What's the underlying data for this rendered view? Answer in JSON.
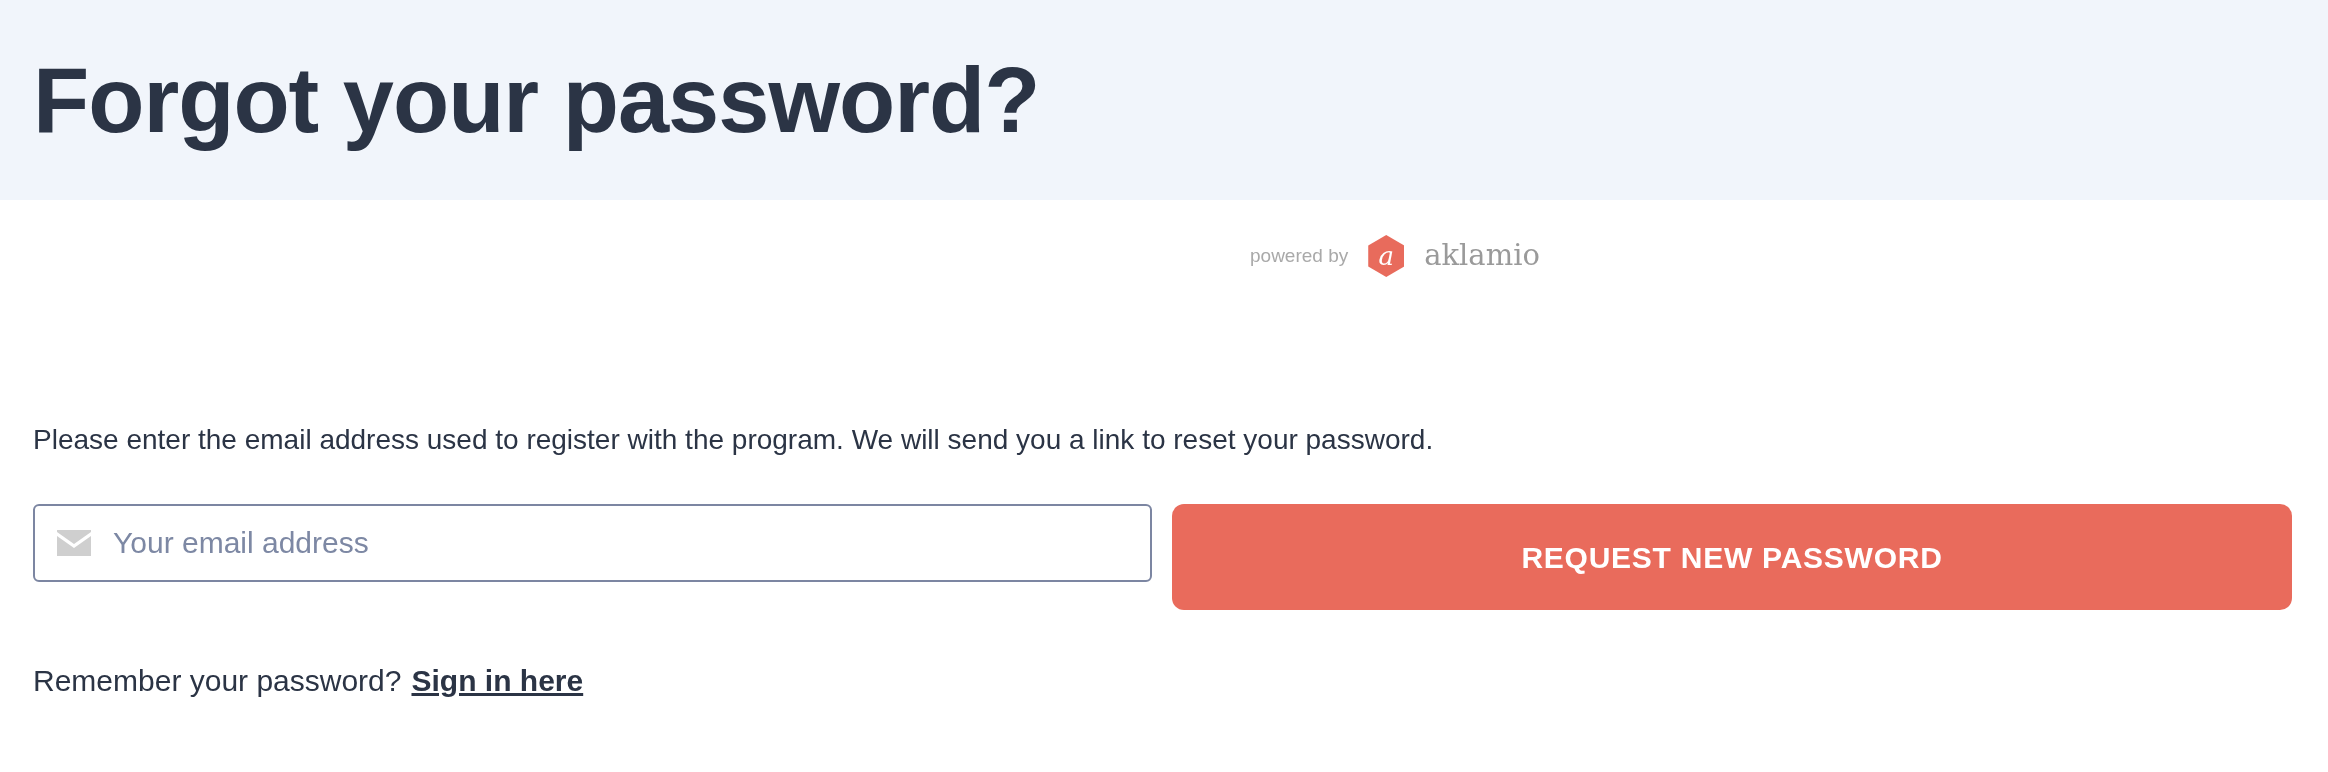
{
  "header": {
    "title": "Forgot your password?"
  },
  "branding": {
    "powered_by": "powered by",
    "logo_letter": "a",
    "brand": "aklamio"
  },
  "instructions": "Please enter the email address used to register with the program. We will send you a link to reset your password.",
  "email_field": {
    "placeholder": "Your email address"
  },
  "submit_button": "REQUEST NEW PASSWORD",
  "footer": {
    "prompt": "Remember your password?",
    "link": "Sign in here"
  }
}
